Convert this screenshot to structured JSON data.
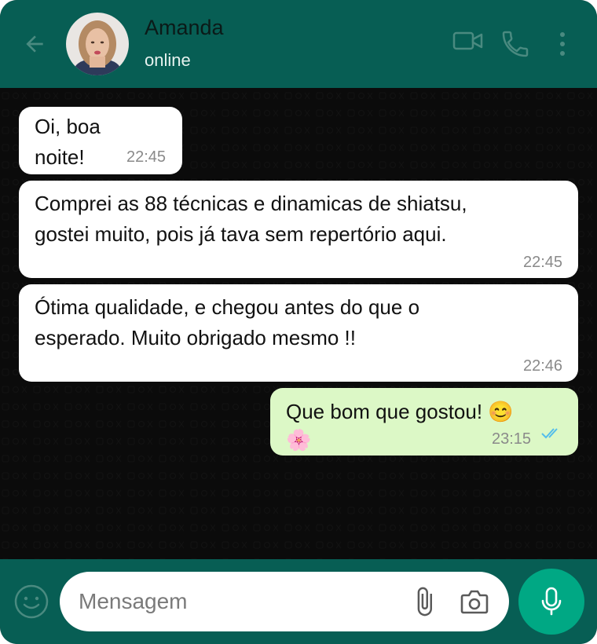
{
  "header": {
    "contact_name": "Amanda",
    "contact_status": "online",
    "icons": [
      "back-arrow-icon",
      "video-call-icon",
      "voice-call-icon",
      "more-vertical-icon"
    ]
  },
  "messages": [
    {
      "direction": "incoming",
      "text": "Oi, boa\nnoite!",
      "time": "22:45"
    },
    {
      "direction": "incoming",
      "text": "Comprei as 88 técnicas e dinamicas de shiatsu,\ngostei muito, pois já tava sem repertório aqui.",
      "time": "22:45"
    },
    {
      "direction": "incoming",
      "text": "Ótima qualidade, e chegou antes do que o\nesperado. Muito obrigado mesmo !!",
      "time": "22:46"
    },
    {
      "direction": "outgoing",
      "text": "Que bom que gostou! 😊\n🌸",
      "time": "23:15",
      "receipt": "read-double-check"
    }
  ],
  "composer": {
    "placeholder": "Mensagem",
    "icons": [
      "emoji-icon",
      "attach-icon",
      "camera-icon",
      "microphone-icon"
    ]
  },
  "colors": {
    "header": "#075e54",
    "incoming_bubble": "#ffffff",
    "outgoing_bubble": "#dcf8c6",
    "mic_button": "#00a884",
    "read_ticks": "#53bdeb"
  }
}
